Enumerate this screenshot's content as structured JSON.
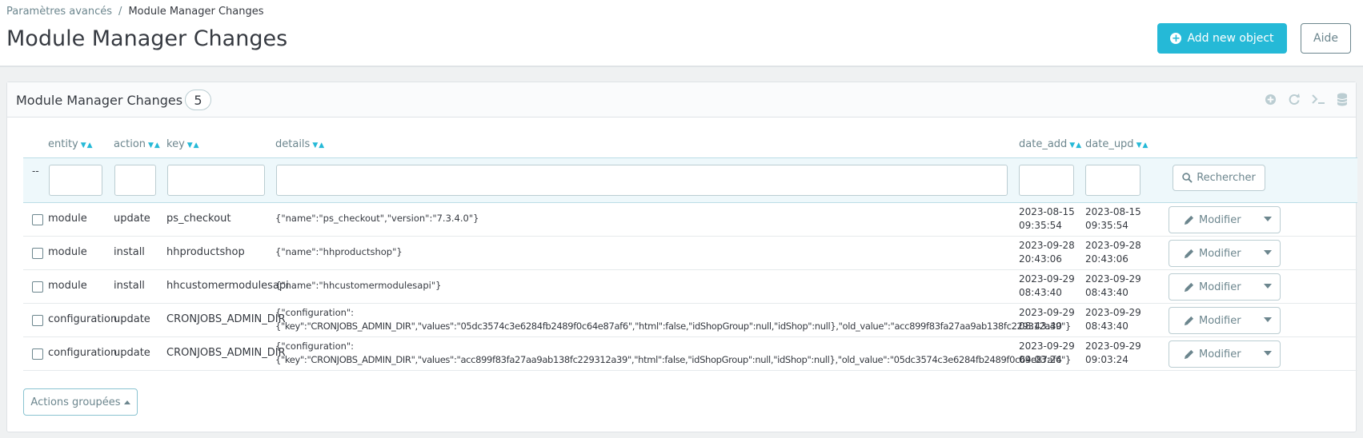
{
  "breadcrumb": {
    "parent": "Paramètres avancés",
    "separator": "/",
    "current": "Module Manager Changes"
  },
  "page": {
    "title": "Module Manager Changes"
  },
  "toolbar": {
    "add_label": "Add new object",
    "help_label": "Aide"
  },
  "panel": {
    "title": "Module Manager Changes",
    "count": "5",
    "tool_icons": [
      "plus-circle-icon",
      "refresh-icon",
      "terminal-icon",
      "database-icon"
    ]
  },
  "columns": {
    "entity": "entity",
    "action": "action",
    "key": "key",
    "details": "details",
    "date_add": "date_add",
    "date_upd": "date_upd",
    "sort_icon": "▼▲"
  },
  "filters": {
    "dash": "--",
    "search_label": "Rechercher"
  },
  "rows": [
    {
      "entity": "module",
      "action": "update",
      "key": "ps_checkout",
      "details": [
        "{\"name\":\"ps_checkout\",\"version\":\"7.3.4.0\"}",
        ""
      ],
      "date_add": [
        "2023-08-15",
        "09:35:54"
      ],
      "date_upd": [
        "2023-08-15",
        "09:35:54"
      ],
      "modify": "Modifier"
    },
    {
      "entity": "module",
      "action": "install",
      "key": "hhproductshop",
      "details": [
        "{\"name\":\"hhproductshop\"}",
        ""
      ],
      "date_add": [
        "2023-09-28",
        "20:43:06"
      ],
      "date_upd": [
        "2023-09-28",
        "20:43:06"
      ],
      "modify": "Modifier"
    },
    {
      "entity": "module",
      "action": "install",
      "key": "hhcustomermodulesapi",
      "details": [
        "{\"name\":\"hhcustomermodulesapi\"}",
        ""
      ],
      "date_add": [
        "2023-09-29",
        "08:43:40"
      ],
      "date_upd": [
        "2023-09-29",
        "08:43:40"
      ],
      "modify": "Modifier"
    },
    {
      "entity": "configuration",
      "action": "update",
      "key": "CRONJOBS_ADMIN_DIR",
      "details": [
        "{\"configuration\":",
        "{\"key\":\"CRONJOBS_ADMIN_DIR\",\"values\":\"05dc3574c3e6284fb2489f0c64e87af6\",\"html\":false,\"idShopGroup\":null,\"idShop\":null},\"old_value\":\"acc899f83fa27aa9ab138fc229312a39\"}"
      ],
      "date_add": [
        "2023-09-29",
        "08:43:40"
      ],
      "date_upd": [
        "2023-09-29",
        "08:43:40"
      ],
      "modify": "Modifier"
    },
    {
      "entity": "configuration",
      "action": "update",
      "key": "CRONJOBS_ADMIN_DIR",
      "details": [
        "{\"configuration\":",
        "{\"key\":\"CRONJOBS_ADMIN_DIR\",\"values\":\"acc899f83fa27aa9ab138fc229312a39\",\"html\":false,\"idShopGroup\":null,\"idShop\":null},\"old_value\":\"05dc3574c3e6284fb2489f0c64e87af6\"}"
      ],
      "date_add": [
        "2023-09-29",
        "09:03:24"
      ],
      "date_upd": [
        "2023-09-29",
        "09:03:24"
      ],
      "modify": "Modifier"
    }
  ],
  "bulk": {
    "label": "Actions groupées"
  }
}
